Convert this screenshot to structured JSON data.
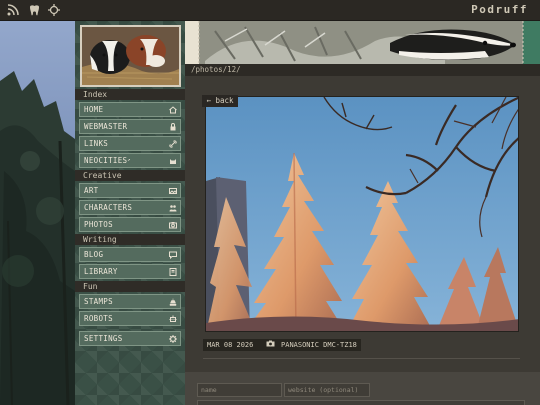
{
  "topbar": {
    "icons": [
      "rss-icon",
      "tooth-icon",
      "crosshair-icon"
    ],
    "brand": "Podruff"
  },
  "path": "/photos/12/",
  "sidebar": {
    "sections": [
      {
        "title": "Index",
        "items": [
          {
            "label": "HOME",
            "icon": "home-icon"
          },
          {
            "label": "WEBMASTER",
            "icon": "lock-icon"
          },
          {
            "label": "LINKS",
            "icon": "link-icon"
          },
          {
            "label": "NEOCITIES",
            "icon": "cat-icon"
          }
        ]
      },
      {
        "title": "Creative",
        "items": [
          {
            "label": "ART",
            "icon": "image-icon"
          },
          {
            "label": "CHARACTERS",
            "icon": "people-icon"
          },
          {
            "label": "PHOTOS",
            "icon": "camera-icon"
          }
        ]
      },
      {
        "title": "Writing",
        "items": [
          {
            "label": "BLOG",
            "icon": "chat-icon"
          },
          {
            "label": "LIBRARY",
            "icon": "book-icon"
          }
        ]
      },
      {
        "title": "Fun",
        "items": [
          {
            "label": "STAMPS",
            "icon": "stamp-icon"
          },
          {
            "label": "ROBOTS",
            "icon": "robot-icon"
          }
        ]
      }
    ],
    "settings": {
      "label": "SETTINGS",
      "icon": "gear-icon"
    }
  },
  "back_label": "← back",
  "photo_meta": {
    "date": "MAR 08 2026",
    "camera": "PANASONIC DMC-TZ18"
  },
  "comment_form": {
    "name_placeholder": "name",
    "website_placeholder": "website (optional)"
  },
  "colors": {
    "sidebar": "#3a5046",
    "nav_button": "#546b5e",
    "main_bg": "#3d3a34",
    "sky": "#5f93c0",
    "snow_lit": "#e2a070"
  }
}
